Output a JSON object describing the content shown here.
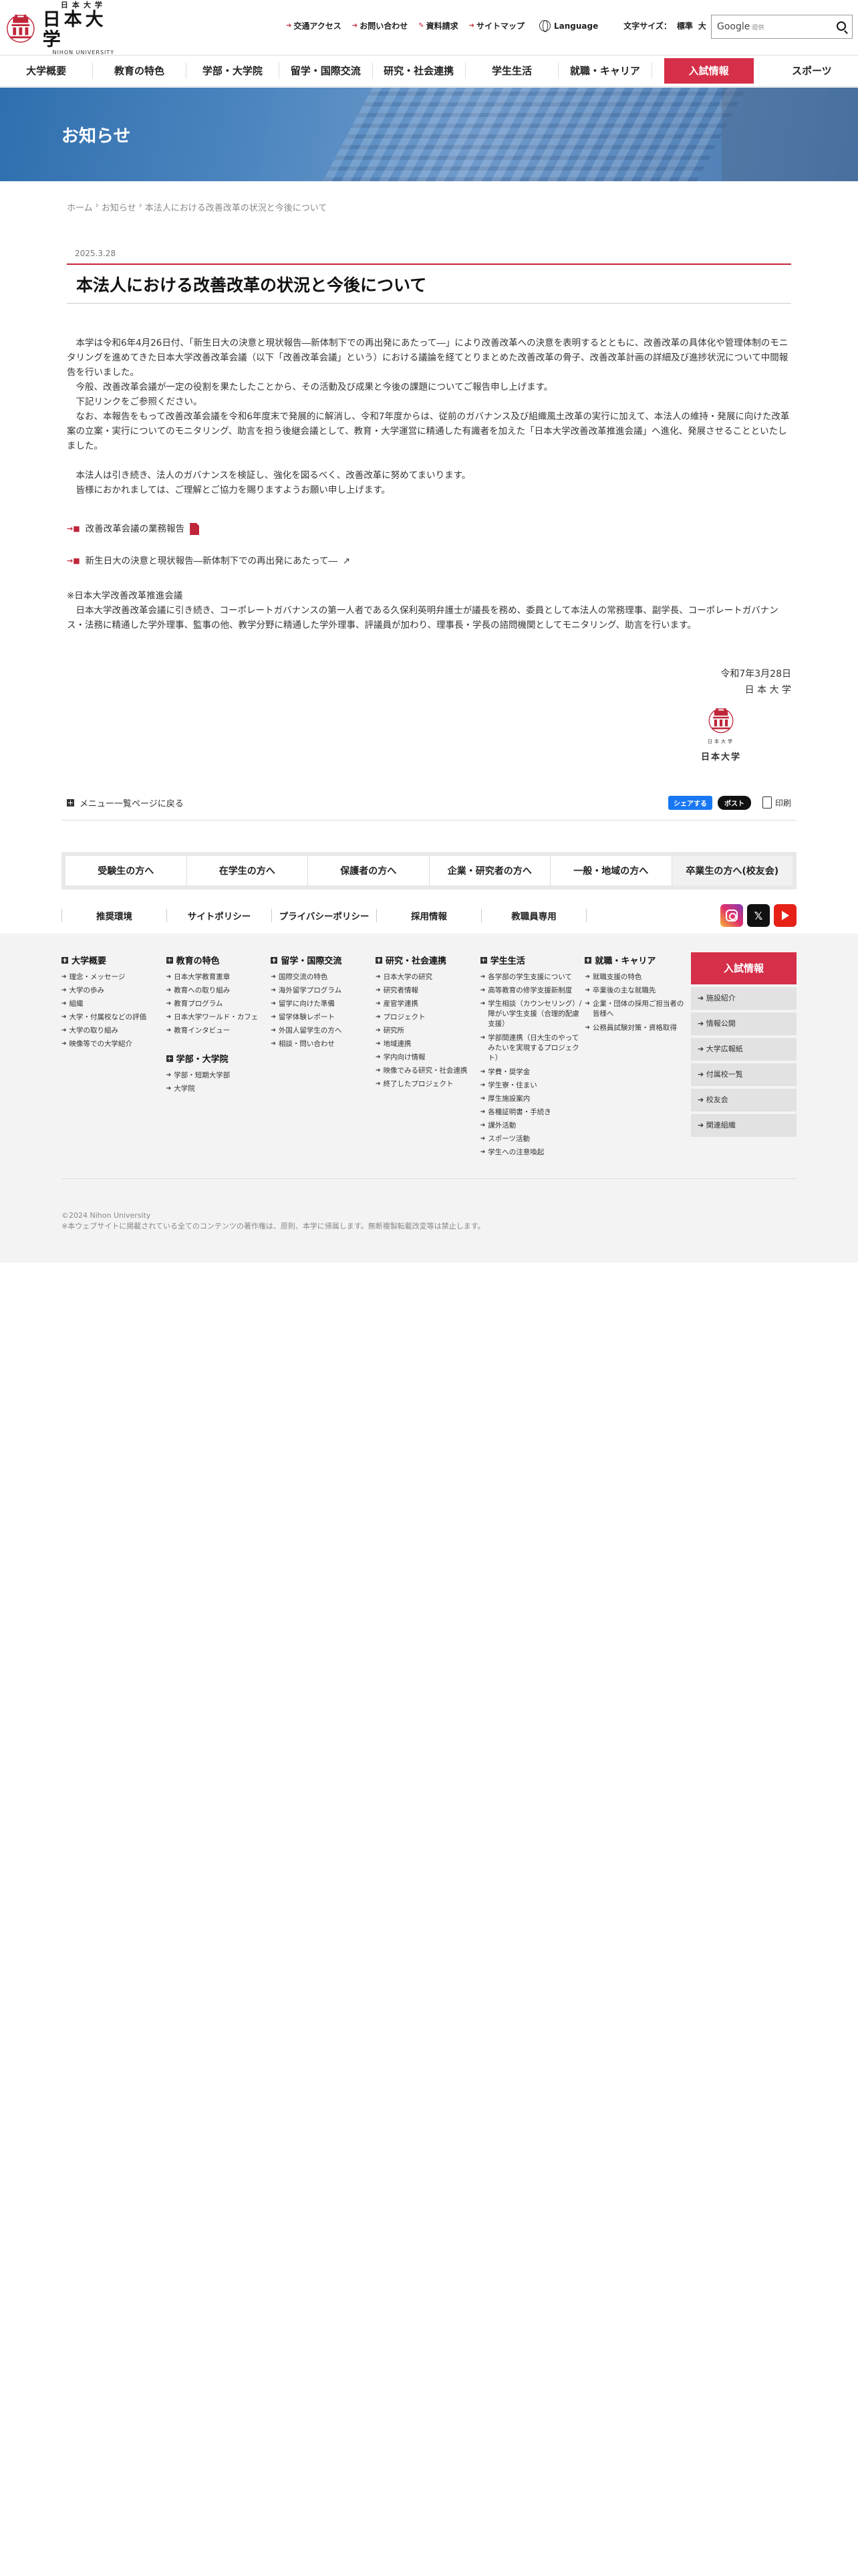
{
  "header": {
    "logo_small": "日本大学",
    "logo_main": "日本大学",
    "logo_en": "NIHON UNIVERSITY",
    "util_links": [
      {
        "label": "交通アクセス",
        "icon": "arrow-right-icon"
      },
      {
        "label": "お問い合わせ",
        "icon": "arrow-right-icon"
      },
      {
        "label": "資料請求",
        "icon": "pencil-icon"
      },
      {
        "label": "サイトマップ",
        "icon": "arrow-right-icon"
      }
    ],
    "language_label": "Language",
    "fontsize_label": "文字サイズ：",
    "fontsize_standard": "標準",
    "fontsize_large": "大",
    "search_label": "Google",
    "search_sub": "提供"
  },
  "gnav": [
    "大学概要",
    "教育の特色",
    "学部・大学院",
    "留学・国際交流",
    "研究・社会連携",
    "学生生活",
    "就職・キャリア",
    "入試情報",
    "スポーツ"
  ],
  "hero": {
    "title": "お知らせ"
  },
  "breadcrumb": [
    "ホーム",
    "お知らせ",
    "本法人における改善改革の状況と今後について"
  ],
  "article": {
    "date": "2025.3.28",
    "title": "本法人における改善改革の状況と今後について",
    "p1": "本学は令和6年4月26日付、「新生日大の決意と現状報告―新体制下での再出発にあたって―」により改善改革への決意を表明するとともに、改善改革の具体化や管理体制のモニタリングを進めてきた日本大学改善改革会議（以下「改善改革会議」という）における議論を経てとりまとめた改善改革の骨子、改善改革計画の詳細及び進捗状況について中間報告を行いました。",
    "p2": "今般、改善改革会議が一定の役割を果たしたことから、その活動及び成果と今後の課題についてご報告申し上げます。",
    "p3": "下記リンクをご参照ください。",
    "p4": "なお、本報告をもって改善改革会議を令和6年度末で発展的に解消し、令和7年度からは、従前のガバナンス及び組織風土改革の実行に加えて、本法人の維持・発展に向けた改革案の立案・実行についてのモニタリング、助言を担う後継会議として、教育・大学運営に精通した有識者を加えた「日本大学改善改革推進会議」へ進化、発展させることといたしました。",
    "p5": "本法人は引き続き、法人のガバナンスを検証し、強化を図るべく、改善改革に努めてまいります。",
    "p6": "皆様におかれましては、ご理解とご協力を賜りますようお願い申し上げます。",
    "link1": "改善改革会議の業務報告",
    "link2": "新生日大の決意と現状報告―新体制下での再出発にあたって―",
    "note_title": "※日本大学改善改革推進会議",
    "note_body": "日本大学改善改革会議に引き続き、コーポレートガバナンスの第一人者である久保利英明弁護士が議長を務め、委員として本法人の常務理事、副学長、コーポレートガバナンス・法務に精通した学外理事、監事の他、教学分野に精通した学外理事、評議員が加わり、理事長・学長の諮問機関としてモニタリング、助言を行います。",
    "sig_date": "令和7年3月28日",
    "sig_name": "日 本 大 学",
    "seal_mini": "日本大学",
    "seal_text": "日本大学"
  },
  "actions": {
    "back": "メニュー一覧ページに戻る",
    "fb": "シェアする",
    "x": "ポスト",
    "print": "印刷"
  },
  "audience": [
    "受験生の方へ",
    "在学生の方へ",
    "保護者の方へ",
    "企業・研究者の方へ",
    "一般・地域の方へ",
    "卒業生の方へ(校友会)"
  ],
  "sublinks": [
    "推奨環境",
    "サイトポリシー",
    "プライバシーポリシー",
    "採用情報",
    "教職員専用"
  ],
  "sitemap": {
    "cols": [
      {
        "groups": [
          {
            "head": "大学概要",
            "links": [
              "理念・メッセージ",
              "大学の歩み",
              "組織",
              "大学・付属校などの評価",
              "大学の取り組み",
              "映像等での大学紹介"
            ]
          }
        ]
      },
      {
        "groups": [
          {
            "head": "教育の特色",
            "links": [
              "日本大学教育憲章",
              "教育への取り組み",
              "教育プログラム",
              "日本大学ワールド・カフェ",
              "教育インタビュー"
            ]
          },
          {
            "head": "学部・大学院",
            "links": [
              "学部・短期大学部",
              "大学院"
            ]
          }
        ]
      },
      {
        "groups": [
          {
            "head": "留学・国際交流",
            "links": [
              "国際交流の特色",
              "海外留学プログラム",
              "留学に向けた準備",
              "留学体験レポート",
              "外国人留学生の方へ",
              "相談・問い合わせ"
            ]
          }
        ]
      },
      {
        "groups": [
          {
            "head": "研究・社会連携",
            "links": [
              "日本大学の研究",
              "研究者情報",
              "産官学連携",
              "プロジェクト",
              "研究所",
              "地域連携",
              "学内向け情報",
              "映像でみる研究・社会連携",
              "終了したプロジェクト"
            ]
          }
        ]
      },
      {
        "groups": [
          {
            "head": "学生生活",
            "links": [
              "各学部の学生支援について",
              "高等教育の修学支援新制度",
              "学生相談（カウンセリング）/障がい学生支援（合理的配慮支援）",
              "学部間連携（日大生のやってみたいを実現するプロジェクト）",
              "学費・奨学金",
              "学生寮・住まい",
              "厚生施設案内",
              "各種証明書・手続き",
              "課外活動",
              "スポーツ活動",
              "学生への注意喚起"
            ]
          }
        ]
      },
      {
        "groups": [
          {
            "head": "就職・キャリア",
            "links": [
              "就職支援の特色",
              "卒業後の主な就職先",
              "企業・団体の採用ご担当者の皆様へ",
              "公務員試験対策・資格取得"
            ]
          }
        ]
      }
    ],
    "side_exam": "入試情報",
    "side_items": [
      "施設紹介",
      "情報公開",
      "大学広報紙",
      "付属校一覧",
      "校友会",
      "関連組織"
    ],
    "copyright": "©2024 Nihon University",
    "copy_note": "※本ウェブサイトに掲載されている全てのコンテンツの著作権は、原則、本学に帰属します。無断複製転載改変等は禁止します。"
  },
  "colors": {
    "accent": "#d62f49",
    "rule": "#c0263a"
  }
}
